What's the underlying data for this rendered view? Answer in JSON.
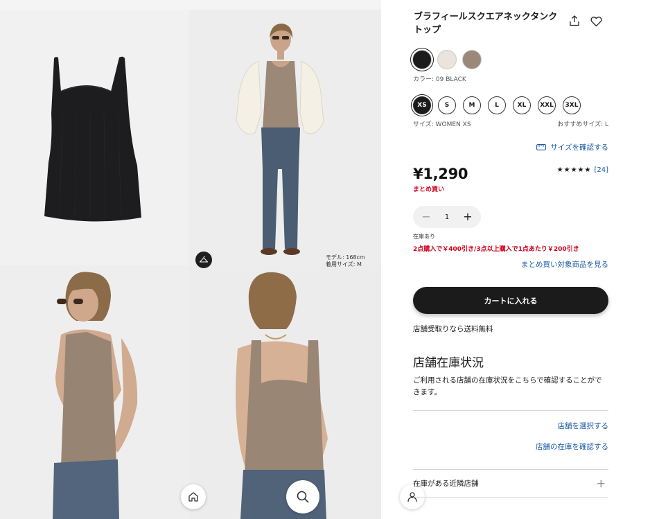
{
  "product": {
    "title": "ブラフィールスクエアネックタンクトップ",
    "color_label": "カラー: 09 BLACK",
    "size_label": "サイズ: WOMEN XS",
    "recommended_size": "おすすめサイズ: L",
    "size_check_link": "サイズを確認する",
    "price": "¥1,290",
    "matome_label": "まとめ買い",
    "rating_stars": "★★★★★",
    "review_count": "[24]",
    "quantity": "1",
    "stock_status": "在庫あり",
    "promo_text": "2点購入で￥400引き/3点以上購入で1点あたり￥200引き",
    "bundle_link": "まとめ買い対象商品を見る",
    "cart_button": "カートに入れる",
    "free_shipping": "店舗受取りなら送料無料"
  },
  "colors": [
    {
      "name": "black",
      "hex": "#1b1b1b",
      "selected": true
    },
    {
      "name": "off-white",
      "hex": "#eae4dc",
      "selected": false
    },
    {
      "name": "brown",
      "hex": "#9c8878",
      "selected": false
    }
  ],
  "sizes": [
    {
      "label": "XS",
      "selected": true
    },
    {
      "label": "S",
      "selected": false
    },
    {
      "label": "M",
      "selected": false
    },
    {
      "label": "L",
      "selected": false
    },
    {
      "label": "XL",
      "selected": false
    },
    {
      "label": "XXL",
      "selected": false
    },
    {
      "label": "3XL",
      "selected": false
    }
  ],
  "gallery": {
    "model_height": "モデル: 168cm",
    "model_size": "着用サイズ: M"
  },
  "store": {
    "heading": "店舗在庫状況",
    "description": "ご利用される店舗の在庫状況をこちらで確認することができます。",
    "select_link": "店舗を選択する",
    "check_link": "店舗の在庫を確認する",
    "nearby_label": "在庫がある近隣店舗"
  },
  "theme": {
    "accent_link": "#1a5ba8",
    "sale_red": "#d0021b",
    "primary": "#1b1b1b"
  }
}
